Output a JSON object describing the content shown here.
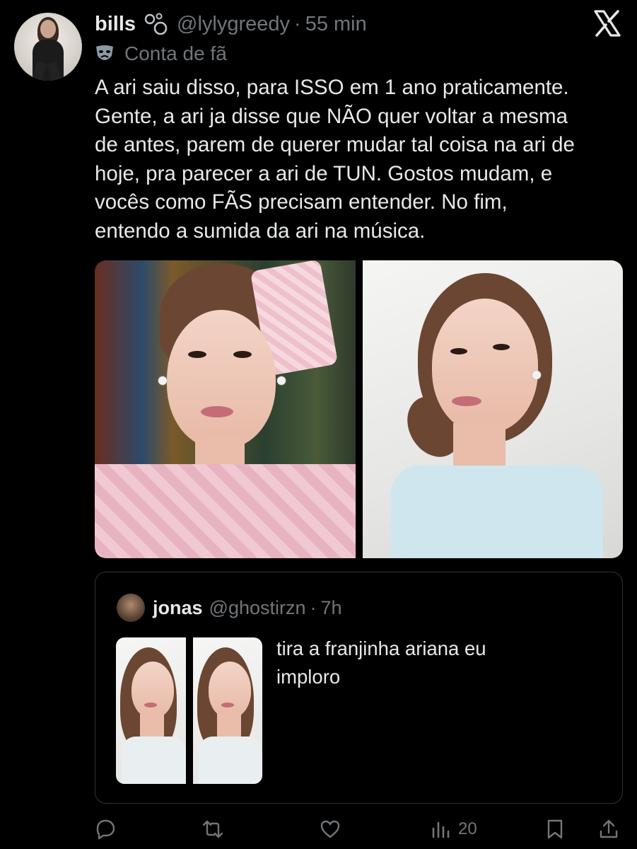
{
  "tweet": {
    "display_name": "bills",
    "handle": "@lylygreedy",
    "separator": "·",
    "time": "55 min",
    "account_label": "Conta de fã",
    "text_lines": [
      "A ari saiu disso, para ISSO em 1 ano praticamente.",
      "Gente, a ari ja disse que NÃO quer voltar a mesma",
      "de antes, parem de querer mudar tal coisa na ari de",
      "hoje, pra parecer a ari de TUN. Gostos mudam, e",
      "vocês como FÃS precisam entender. No fim,",
      "entendo a sumida da ari na música."
    ]
  },
  "quoted_tweet": {
    "display_name": "jonas",
    "handle": "@ghostirzn",
    "separator": "·",
    "time": "7h",
    "text_lines": [
      "tira a franjinha ariana eu",
      "imploro"
    ]
  },
  "actions": {
    "views_count": "20"
  },
  "colors": {
    "background": "#000000",
    "primary_text": "#e7e9ea",
    "secondary_text": "#71767b",
    "border": "#2f3336"
  },
  "icons": [
    "x-logo-icon",
    "theater-mask-icon",
    "reply-icon",
    "retweet-icon",
    "like-icon",
    "views-icon",
    "bookmark-icon",
    "share-icon"
  ]
}
